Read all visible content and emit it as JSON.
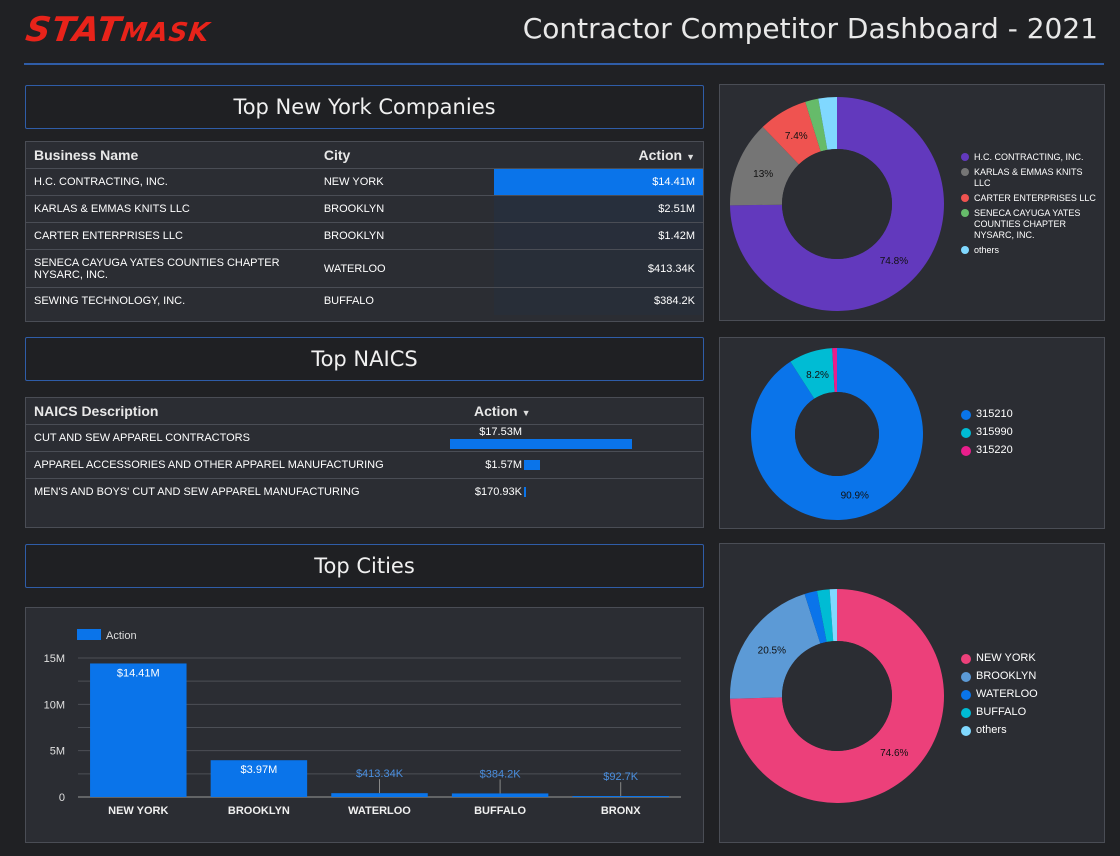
{
  "header": {
    "logo_text_big": "STAT",
    "logo_text_small": "MASK",
    "title": "Contractor Competitor Dashboard - 2021"
  },
  "companies": {
    "title": "Top New York Companies",
    "columns": [
      "Business Name",
      "City",
      "Action"
    ],
    "sort_icon": "▼",
    "rows": [
      {
        "name": "H.C. CONTRACTING, INC.",
        "city": "NEW YORK",
        "action": "$14.41M",
        "value": 14.41
      },
      {
        "name": "KARLAS & EMMAS KNITS LLC",
        "city": "BROOKLYN",
        "action": "$2.51M",
        "value": 2.51
      },
      {
        "name": "CARTER ENTERPRISES LLC",
        "city": "BROOKLYN",
        "action": "$1.42M",
        "value": 1.42
      },
      {
        "name": "SENECA CAYUGA YATES COUNTIES CHAPTER NYSARC, INC.",
        "city": "WATERLOO",
        "action": "$413.34K",
        "value": 0.41334
      },
      {
        "name": "SEWING TECHNOLOGY, INC.",
        "city": "BUFFALO",
        "action": "$384.2K",
        "value": 0.3842
      }
    ]
  },
  "naics": {
    "title": "Top NAICS",
    "columns": [
      "NAICS Description",
      "Action"
    ],
    "sort_icon": "▼",
    "rows": [
      {
        "desc": "CUT AND SEW APPAREL CONTRACTORS",
        "action": "$17.53M",
        "value": 17.53
      },
      {
        "desc": "APPAREL ACCESSORIES AND OTHER APPAREL MANUFACTURING",
        "action": "$1.57M",
        "value": 1.57
      },
      {
        "desc": "MEN'S AND BOYS' CUT AND SEW APPAREL MANUFACTURING",
        "action": "$170.93K",
        "value": 0.17093
      }
    ]
  },
  "cities": {
    "title": "Top Cities"
  },
  "chart_data": [
    {
      "type": "pie",
      "title": "",
      "labels": [
        "H.C. CONTRACTING, INC.",
        "KARLAS & EMMAS KNITS LLC",
        "CARTER ENTERPRISES LLC",
        "SENECA CAYUGA YATES COUNTIES CHAPTER NYSARC, INC.",
        "others"
      ],
      "values": [
        74.8,
        13.0,
        7.4,
        2.0,
        2.8
      ],
      "value_labels": [
        "74.8%",
        "13%",
        "7.4%",
        "",
        ""
      ],
      "colors": [
        "#6239bd",
        "#757575",
        "#ef5350",
        "#66bb6a",
        "#80d8ff"
      ],
      "legend": "right"
    },
    {
      "type": "pie",
      "title": "",
      "labels": [
        "315210",
        "315990",
        "315220"
      ],
      "values": [
        90.9,
        8.2,
        0.9
      ],
      "value_labels": [
        "90.9%",
        "8.2%",
        ""
      ],
      "colors": [
        "#0a74ea",
        "#00bcd4",
        "#e91e8c"
      ],
      "legend": "right"
    },
    {
      "type": "bar",
      "title": "",
      "categories": [
        "NEW YORK",
        "BROOKLYN",
        "WATERLOO",
        "BUFFALO",
        "BRONX"
      ],
      "series": [
        {
          "name": "Action",
          "values": [
            14.41,
            3.97,
            0.41334,
            0.3842,
            0.0927
          ]
        }
      ],
      "value_labels": [
        "$14.41M",
        "$3.97M",
        "$413.34K",
        "$384.2K",
        "$92.7K"
      ],
      "ylim": [
        0,
        15
      ],
      "yticks": [
        0,
        5,
        10,
        15
      ],
      "ytick_labels": [
        "0",
        "5M",
        "10M",
        "15M"
      ],
      "color": "#0a74ea",
      "grid": true,
      "legend": "top-left"
    },
    {
      "type": "pie",
      "title": "",
      "labels": [
        "NEW YORK",
        "BROOKLYN",
        "WATERLOO",
        "BUFFALO",
        "others"
      ],
      "values": [
        74.6,
        20.5,
        1.9,
        1.9,
        1.1
      ],
      "value_labels": [
        "74.6%",
        "20.5%",
        "",
        "",
        ""
      ],
      "colors": [
        "#ec407a",
        "#5c9ad6",
        "#0a74ea",
        "#00bcd4",
        "#80d8ff"
      ],
      "legend": "right"
    }
  ]
}
